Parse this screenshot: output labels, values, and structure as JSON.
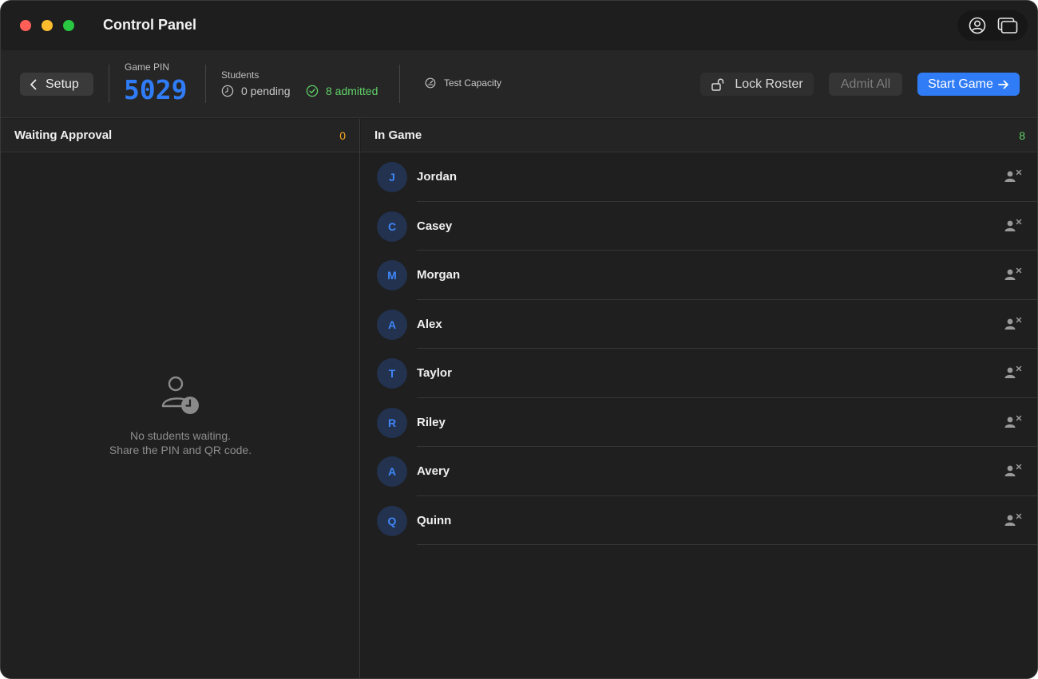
{
  "window": {
    "title": "Control Panel"
  },
  "toolbar": {
    "back_label": "Setup",
    "pin_label": "Game PIN",
    "pin_value": "5029",
    "students_label": "Students",
    "pending_text": "0 pending",
    "admitted_text": "8 admitted",
    "test_capacity_label": "Test Capacity",
    "lock_roster_label": "Lock Roster",
    "admit_all_label": "Admit All",
    "start_game_label": "Start Game"
  },
  "waiting": {
    "title": "Waiting Approval",
    "count": "0",
    "empty_line1": "No students waiting.",
    "empty_line2": "Share the PIN and QR code."
  },
  "in_game": {
    "title": "In Game",
    "count": "8",
    "players": [
      {
        "initial": "J",
        "name": "Jordan"
      },
      {
        "initial": "C",
        "name": "Casey"
      },
      {
        "initial": "M",
        "name": "Morgan"
      },
      {
        "initial": "A",
        "name": "Alex"
      },
      {
        "initial": "T",
        "name": "Taylor"
      },
      {
        "initial": "R",
        "name": "Riley"
      },
      {
        "initial": "A",
        "name": "Avery"
      },
      {
        "initial": "Q",
        "name": "Quinn"
      }
    ]
  },
  "colors": {
    "accent": "#2f7cf6",
    "admitted": "#5fd067",
    "waiting_count": "#f5a623",
    "avatar_bg": "#22324f"
  },
  "icons": {
    "account": "person-circle-icon",
    "windows": "windows-icon",
    "back": "chevron-left-icon",
    "pending": "clock-icon",
    "admitted": "check-circle-icon",
    "test_capacity": "gauge-icon",
    "lock": "lock-open-icon",
    "start": "arrow-right-icon",
    "empty": "person-clock-icon",
    "remove": "person-remove-icon"
  }
}
